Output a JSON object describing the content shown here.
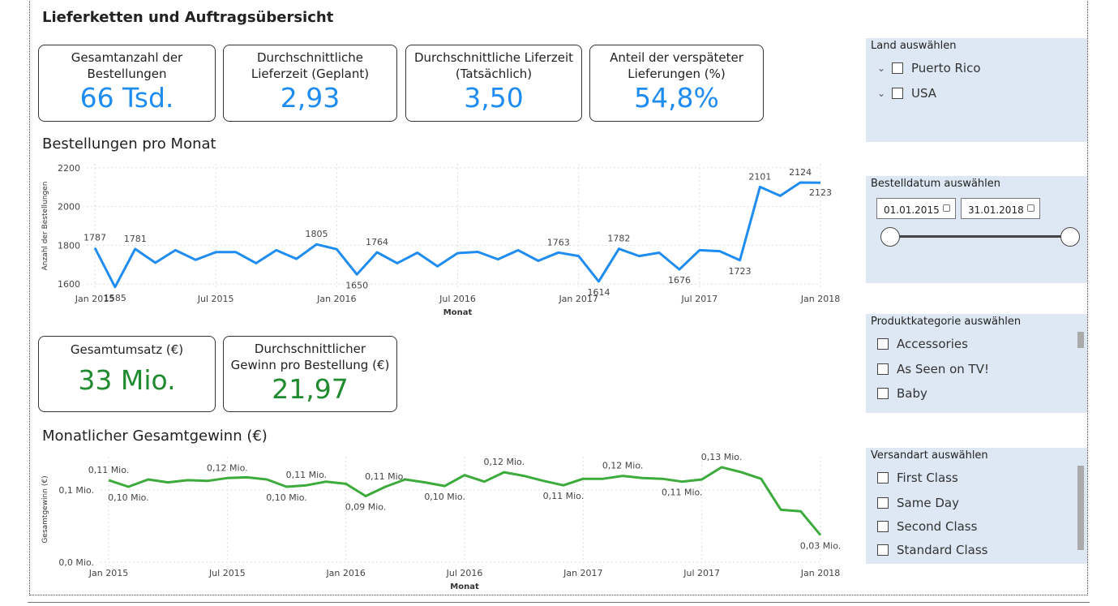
{
  "title": "Lieferketten und Auftragsübersicht",
  "kpis": {
    "orders": {
      "label1": "Gesamtanzahl der",
      "label2": "Bestellungen",
      "value": "66 Tsd."
    },
    "planned": {
      "label1": "Durchschnittliche",
      "label2": "Lieferzeit (Geplant)",
      "value": "2,93"
    },
    "actual": {
      "label1": "Durchschnittliche Liferzeit",
      "label2": "(Tatsächlich)",
      "value": "3,50"
    },
    "late": {
      "label1": "Anteil der verspäteter",
      "label2": "Lieferungen (%)",
      "value": "54,8%"
    },
    "revenue": {
      "label1": "Gesamtumsatz (€)",
      "value": "33 Mio."
    },
    "profit_per_order": {
      "label1": "Durchschnittlicher",
      "label2": "Gewinn pro Bestellung (€)",
      "value": "21,97"
    }
  },
  "chart1_title": "Bestellungen pro Monat",
  "chart2_title": "Monatlicher Gesamtgewinn (€)",
  "slicers": {
    "country": {
      "title": "Land auswählen",
      "options": [
        "Puerto Rico",
        "USA"
      ]
    },
    "date": {
      "title": "Bestelldatum auswählen",
      "start": "01.01.2015",
      "end": "31.01.2018"
    },
    "category": {
      "title": "Produktkategorie auswählen",
      "options": [
        "Accessories",
        "As Seen on TV!",
        "Baby"
      ]
    },
    "shipping": {
      "title": "Versandart auswählen",
      "options": [
        "First Class",
        "Same Day",
        "Second Class",
        "Standard Class"
      ]
    }
  },
  "colors": {
    "blue_line": "#1e8cf0",
    "green_line": "#3cab3c",
    "blue_kpi": "#1e8cf0",
    "green_kpi": "#1f8a2e",
    "slicer_bg": "#dde8f4"
  },
  "chart_data": [
    {
      "type": "line",
      "title": "Bestellungen pro Monat",
      "xlabel": "Monat",
      "ylabel": "Anzahl der Bestellungen",
      "x_ticks": [
        "Jan 2015",
        "Jul 2015",
        "Jan 2016",
        "Jul 2016",
        "Jan 2017",
        "Jul 2017",
        "Jan 2018"
      ],
      "y_ticks": [
        "1600",
        "1800",
        "2000",
        "2200"
      ],
      "ylim": [
        1580,
        2220
      ],
      "grid": true,
      "series": [
        {
          "values": [
            1787,
            1585,
            1781,
            1710,
            1775,
            1725,
            1765,
            1765,
            1708,
            1775,
            1730,
            1805,
            1780,
            1650,
            1764,
            1708,
            1762,
            1692,
            1760,
            1766,
            1728,
            1775,
            1720,
            1763,
            1745,
            1614,
            1782,
            1745,
            1762,
            1676,
            1775,
            1770,
            1723,
            2101,
            2055,
            2124,
            2123
          ]
        }
      ],
      "data_labels": [
        {
          "i": 0,
          "text": "1787"
        },
        {
          "i": 1,
          "text": "1585"
        },
        {
          "i": 2,
          "text": "1781"
        },
        {
          "i": 11,
          "text": "1805"
        },
        {
          "i": 13,
          "text": "1650"
        },
        {
          "i": 14,
          "text": "1764"
        },
        {
          "i": 23,
          "text": "1763"
        },
        {
          "i": 25,
          "text": "1614"
        },
        {
          "i": 26,
          "text": "1782"
        },
        {
          "i": 29,
          "text": "1676"
        },
        {
          "i": 32,
          "text": "1723"
        },
        {
          "i": 33,
          "text": "2101"
        },
        {
          "i": 35,
          "text": "2124"
        },
        {
          "i": 36,
          "text": "2123"
        }
      ]
    },
    {
      "type": "line",
      "title": "Monatlicher Gesamtgewinn (€)",
      "xlabel": "Monat",
      "ylabel": "Gesamtgewinn (€)",
      "x_ticks": [
        "Jan 2015",
        "Jul 2015",
        "Jan 2016",
        "Jul 2016",
        "Jan 2017",
        "Jul 2017",
        "Jan 2018"
      ],
      "y_ticks": [
        "0,0 Mio.",
        "0,1 Mio."
      ],
      "ylim": [
        0,
        0.146
      ],
      "grid": true,
      "series": [
        {
          "values": [
            0.1135,
            0.1045,
            0.1145,
            0.1105,
            0.1135,
            0.1125,
            0.1165,
            0.1175,
            0.1145,
            0.1045,
            0.1065,
            0.1115,
            0.1085,
            0.0915,
            0.1045,
            0.1145,
            0.1105,
            0.1055,
            0.1205,
            0.1115,
            0.1245,
            0.1195,
            0.1125,
            0.1065,
            0.1155,
            0.1155,
            0.1195,
            0.1165,
            0.1155,
            0.1115,
            0.1145,
            0.1315,
            0.1245,
            0.1155,
            0.0725,
            0.0705,
            0.0375
          ]
        }
      ],
      "data_labels": [
        {
          "i": 0,
          "text": "0,11 Mio."
        },
        {
          "i": 1,
          "text": "0,10 Mio."
        },
        {
          "i": 6,
          "text": "0,12 Mio."
        },
        {
          "i": 9,
          "text": "0,10 Mio."
        },
        {
          "i": 10,
          "text": "0,11 Mio."
        },
        {
          "i": 13,
          "text": "0,09 Mio."
        },
        {
          "i": 14,
          "text": "0,11 Mio."
        },
        {
          "i": 17,
          "text": "0,10 Mio."
        },
        {
          "i": 20,
          "text": "0,12 Mio."
        },
        {
          "i": 23,
          "text": "0,11 Mio."
        },
        {
          "i": 26,
          "text": "0,12 Mio."
        },
        {
          "i": 29,
          "text": "0,11 Mio."
        },
        {
          "i": 31,
          "text": "0,13 Mio."
        },
        {
          "i": 36,
          "text": "0,03 Mio."
        }
      ]
    }
  ]
}
